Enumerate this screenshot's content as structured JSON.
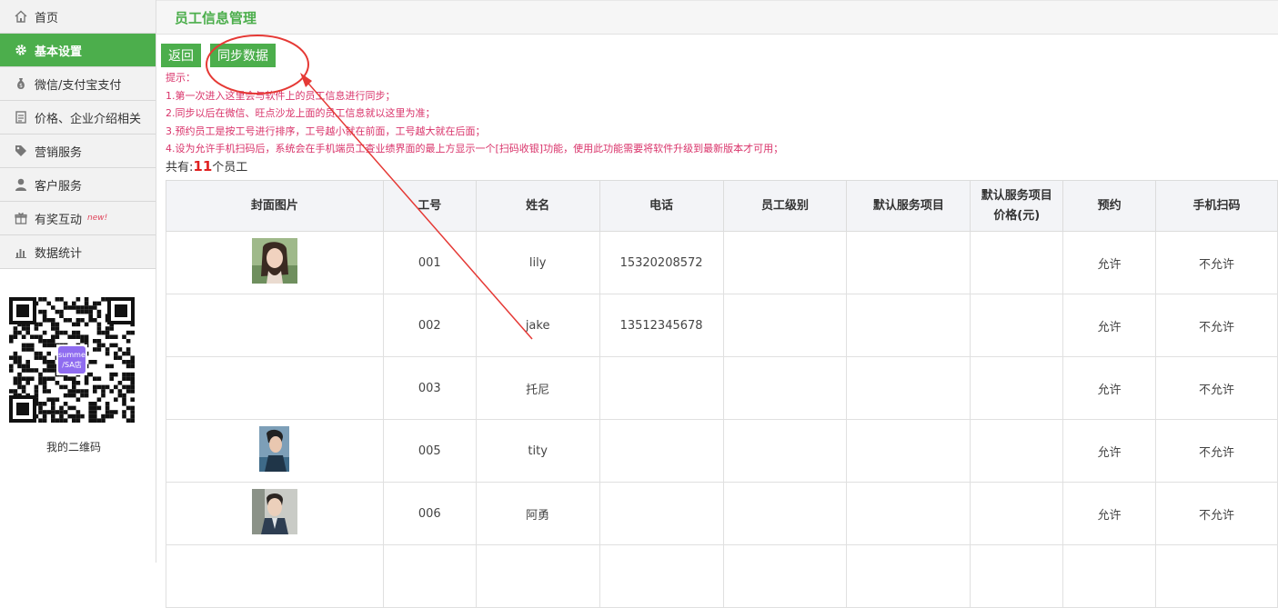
{
  "sidebar": {
    "items": [
      {
        "label": "首页",
        "icon": "home-icon"
      },
      {
        "label": "基本设置",
        "icon": "gear-icon",
        "active": true
      },
      {
        "label": "微信/支付宝支付",
        "icon": "money-bag-icon"
      },
      {
        "label": "价格、企业介绍相关",
        "icon": "document-icon"
      },
      {
        "label": "营销服务",
        "icon": "tag-icon"
      },
      {
        "label": "客户服务",
        "icon": "user-icon"
      },
      {
        "label": "有奖互动",
        "icon": "gift-icon",
        "badge": "new!"
      },
      {
        "label": "数据统计",
        "icon": "bar-chart-icon"
      }
    ],
    "qr_badge": "summe\n/SA店",
    "qr_caption": "我的二维码"
  },
  "header": {
    "title": "员工信息管理"
  },
  "toolbar": {
    "back_label": "返回",
    "sync_label": "同步数据"
  },
  "tips": {
    "heading": "提示：",
    "lines": [
      "1.第一次进入这里会与软件上的员工信息进行同步；",
      "2.同步以后在微信、旺点沙龙上面的员工信息就以这里为准；",
      "3.预约员工是按工号进行排序，工号越小就在前面，工号越大就在后面；",
      "4.设为允许手机扫码后，系统会在手机端员工查业绩界面的最上方显示一个[扫码收银]功能，使用此功能需要将软件升级到最新版本才可用；"
    ]
  },
  "summary": {
    "prefix": "共有:",
    "count": "11",
    "suffix": "个员工"
  },
  "table": {
    "headers": [
      "封面图片",
      "工号",
      "姓名",
      "电话",
      "员工级别",
      "默认服务项目",
      "默认服务项目\n价格(元)",
      "预约",
      "手机扫码"
    ],
    "rows": [
      {
        "has_photo": true,
        "photo": "avatar-woman",
        "id": "001",
        "name": "lily",
        "phone": "15320208572",
        "level": "",
        "service": "",
        "price": "",
        "booking": "允许",
        "scan": "不允许"
      },
      {
        "has_photo": false,
        "id": "002",
        "name": "jake",
        "phone": "13512345678",
        "level": "",
        "service": "",
        "price": "",
        "booking": "允许",
        "scan": "不允许"
      },
      {
        "has_photo": false,
        "id": "003",
        "name": "托尼",
        "phone": "",
        "level": "",
        "service": "",
        "price": "",
        "booking": "允许",
        "scan": "不允许"
      },
      {
        "has_photo": true,
        "photo": "avatar-man-profile",
        "id": "005",
        "name": "tity",
        "phone": "",
        "level": "",
        "service": "",
        "price": "",
        "booking": "允许",
        "scan": "不允许"
      },
      {
        "has_photo": true,
        "photo": "avatar-man-jacket",
        "id": "006",
        "name": "阿勇",
        "phone": "",
        "level": "",
        "service": "",
        "price": "",
        "booking": "允许",
        "scan": "不允许"
      },
      {
        "has_photo": false,
        "id": "",
        "name": "",
        "phone": "",
        "level": "",
        "service": "",
        "price": "",
        "booking": "",
        "scan": ""
      }
    ]
  },
  "colors": {
    "accent": "#4cae4c",
    "tip_text": "#d9336a",
    "count_text": "#e02020",
    "annotation": "#e53935"
  }
}
